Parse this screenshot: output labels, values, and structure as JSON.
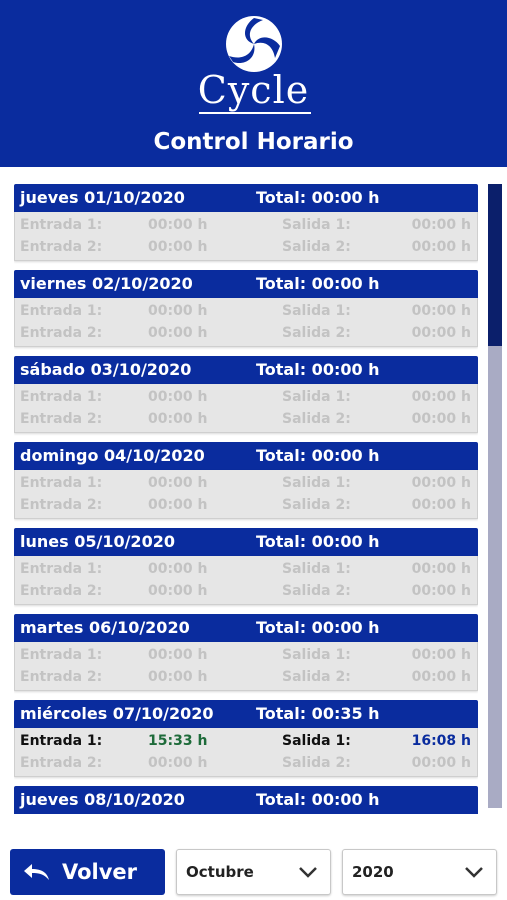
{
  "header": {
    "brand": "Cycle",
    "title": "Control Horario",
    "bg_color": "#0a2c9e"
  },
  "days": [
    {
      "date_label": "jueves 01/10/2020",
      "total": "Total: 00:00 h",
      "entry1_label": "Entrada 1:",
      "entry1_value": "00:00 h",
      "exit1_label": "Salida 1:",
      "exit1_value": "00:00 h",
      "entry2_label": "Entrada 2:",
      "entry2_value": "00:00 h",
      "exit2_label": "Salida 2:",
      "exit2_value": "00:00 h"
    },
    {
      "date_label": "viernes 02/10/2020",
      "total": "Total: 00:00 h",
      "entry1_label": "Entrada 1:",
      "entry1_value": "00:00 h",
      "exit1_label": "Salida 1:",
      "exit1_value": "00:00 h",
      "entry2_label": "Entrada 2:",
      "entry2_value": "00:00 h",
      "exit2_label": "Salida 2:",
      "exit2_value": "00:00 h"
    },
    {
      "date_label": "sábado 03/10/2020",
      "total": "Total: 00:00 h",
      "entry1_label": "Entrada 1:",
      "entry1_value": "00:00 h",
      "exit1_label": "Salida 1:",
      "exit1_value": "00:00 h",
      "entry2_label": "Entrada 2:",
      "entry2_value": "00:00 h",
      "exit2_label": "Salida 2:",
      "exit2_value": "00:00 h"
    },
    {
      "date_label": "domingo 04/10/2020",
      "total": "Total: 00:00 h",
      "entry1_label": "Entrada 1:",
      "entry1_value": "00:00 h",
      "exit1_label": "Salida 1:",
      "exit1_value": "00:00 h",
      "entry2_label": "Entrada 2:",
      "entry2_value": "00:00 h",
      "exit2_label": "Salida 2:",
      "exit2_value": "00:00 h"
    },
    {
      "date_label": "lunes 05/10/2020",
      "total": "Total: 00:00 h",
      "entry1_label": "Entrada 1:",
      "entry1_value": "00:00 h",
      "exit1_label": "Salida 1:",
      "exit1_value": "00:00 h",
      "entry2_label": "Entrada 2:",
      "entry2_value": "00:00 h",
      "exit2_label": "Salida 2:",
      "exit2_value": "00:00 h"
    },
    {
      "date_label": "martes 06/10/2020",
      "total": "Total: 00:00 h",
      "entry1_label": "Entrada 1:",
      "entry1_value": "00:00 h",
      "exit1_label": "Salida 1:",
      "exit1_value": "00:00 h",
      "entry2_label": "Entrada 2:",
      "entry2_value": "00:00 h",
      "exit2_label": "Salida 2:",
      "exit2_value": "00:00 h"
    },
    {
      "date_label": "miércoles 07/10/2020",
      "total": "Total: 00:35 h",
      "entry1_label": "Entrada 1:",
      "entry1_value": "15:33 h",
      "exit1_label": "Salida 1:",
      "exit1_value": "16:08 h",
      "entry2_label": "Entrada 2:",
      "entry2_value": "00:00 h",
      "exit2_label": "Salida 2:",
      "exit2_value": "00:00 h"
    },
    {
      "date_label": "jueves 08/10/2020",
      "total": "Total: 00:00 h"
    }
  ],
  "footer": {
    "back_label": "Volver",
    "back_icon": "reply-arrow-icon",
    "month_value": "Octubre",
    "year_value": "2020",
    "dropdown_icon": "chevron-down-icon"
  }
}
